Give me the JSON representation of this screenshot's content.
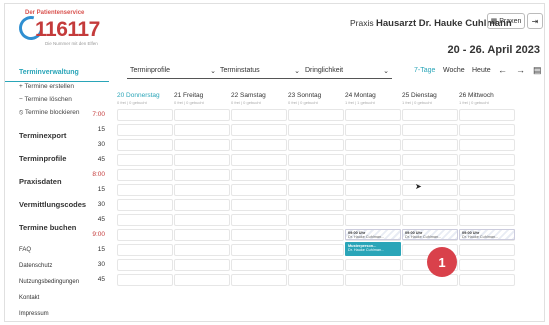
{
  "header": {
    "logo_tagline_top": "Der Patientenservice",
    "logo_number": "116117",
    "logo_tagline_bottom": "Die Nummer mit den Elfen",
    "practice_prefix": "Praxis",
    "practice_name": "Hausarzt Dr. Hauke Cuhlmann",
    "praxen_label": "Praxen",
    "date_range": "20 - 26. April 2023"
  },
  "sidebar": {
    "active_section": "Terminverwaltung",
    "sub_items": [
      "+ Termine erstellen",
      "− Termine löschen",
      "⦸ Termine blockieren"
    ],
    "sections": [
      "Terminexport",
      "Terminprofile",
      "Praxisdaten",
      "Vermittlungscodes",
      "Termine buchen"
    ],
    "footer_links": [
      "FAQ",
      "Datenschutz",
      "Nutzungsbedingungen",
      "Kontakt",
      "Impressum"
    ]
  },
  "toolbar": {
    "filters": [
      "Terminprofile",
      "Terminstatus",
      "Dringlichkeit"
    ],
    "view_options": [
      "7-Tage",
      "Woche",
      "Heute"
    ],
    "active_view": "7-Tage",
    "prev_icon": "arrow-left-icon",
    "next_icon": "arrow-right-icon",
    "calendar_icon": "calendar-icon"
  },
  "calendar": {
    "days": [
      {
        "name": "20 Donnerstag",
        "sub": "0 frei | 0 gebucht",
        "today": true
      },
      {
        "name": "21 Freitag",
        "sub": "0 frei | 0 gebucht",
        "today": false
      },
      {
        "name": "22 Samstag",
        "sub": "0 frei | 0 gebucht",
        "today": false
      },
      {
        "name": "23 Sonntag",
        "sub": "0 frei | 0 gebucht",
        "today": false
      },
      {
        "name": "24 Montag",
        "sub": "1 frei | 1 gebucht",
        "today": false
      },
      {
        "name": "25 Dienstag",
        "sub": "1 frei | 0 gebucht",
        "today": false
      },
      {
        "name": "26 Mittwoch",
        "sub": "1 frei | 0 gebucht",
        "today": false
      }
    ],
    "times": [
      "7:00",
      "15",
      "30",
      "45",
      "8:00",
      "15",
      "30",
      "45",
      "9:00",
      "15",
      "30",
      "45"
    ],
    "events": [
      {
        "day": 4,
        "slot": 8,
        "time": "09:00 Uhr",
        "doctor": "Dr. Hauke Cuhlman...",
        "booked": false
      },
      {
        "day": 5,
        "slot": 8,
        "time": "09:00 Uhr",
        "doctor": "Dr. Hauke Cuhlman...",
        "booked": false
      },
      {
        "day": 6,
        "slot": 8,
        "time": "09:00 Uhr",
        "doctor": "Dr. Hauke Cuhlman...",
        "booked": false
      },
      {
        "day": 4,
        "slot": 9,
        "time": "Musterperson...",
        "doctor": "Dr. Hauke Cuhlman...",
        "booked": true
      }
    ]
  },
  "callout_badge": "1"
}
